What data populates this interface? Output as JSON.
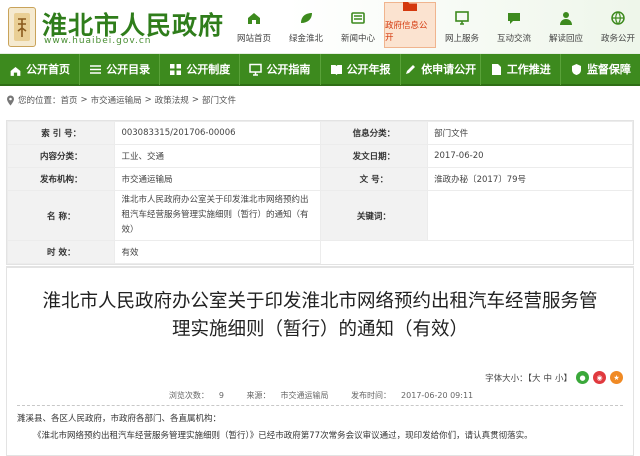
{
  "site": {
    "name": "淮北市人民政府",
    "url": "www.huaibei.gov.cn"
  },
  "topnav": [
    {
      "label": "网站首页",
      "icon": "home-icon"
    },
    {
      "label": "绿金淮北",
      "icon": "leaf-icon"
    },
    {
      "label": "新闻中心",
      "icon": "news-icon"
    },
    {
      "label": "政府信息公开",
      "icon": "folder-icon",
      "active": true
    },
    {
      "label": "网上服务",
      "icon": "computer-icon"
    },
    {
      "label": "互动交流",
      "icon": "chat-icon"
    },
    {
      "label": "解读回应",
      "icon": "person-icon"
    },
    {
      "label": "政务公开",
      "icon": "globe-icon"
    }
  ],
  "mainnav": [
    {
      "label": "公开首页",
      "icon": "home-icon"
    },
    {
      "label": "公开目录",
      "icon": "list-icon"
    },
    {
      "label": "公开制度",
      "icon": "grid-icon"
    },
    {
      "label": "公开指南",
      "icon": "monitor-icon"
    },
    {
      "label": "公开年报",
      "icon": "book-icon"
    },
    {
      "label": "依申请公开",
      "icon": "edit-icon"
    },
    {
      "label": "工作推进",
      "icon": "doc-icon"
    },
    {
      "label": "监督保障",
      "icon": "shield-icon"
    }
  ],
  "breadcrumb": {
    "prefix": "您的位置：",
    "items": [
      "首页",
      "市交通运输局",
      "政策法规",
      "部门文件"
    ],
    "sep": ">"
  },
  "meta": {
    "index_k": "索 引 号：",
    "index_v": "003083315/201706-00006",
    "info_k": "信息分类：",
    "info_v": "部门文件",
    "topic_k": "内容分类：",
    "topic_v": "工业、交通",
    "date_k": "发文日期：",
    "date_v": "2017-06-20",
    "org_k": "发布机构：",
    "org_v": "市交通运输局",
    "num_k": "文 号：",
    "num_v": "淮政办秘〔2017〕79号",
    "name_k": "名 称：",
    "name_v": "淮北市人民政府办公室关于印发淮北市网络预约出租汽车经营服务管理实施细则（暂行）的通知（有效）",
    "kw_k": "关键词：",
    "kw_v": "",
    "eff_k": "时 效：",
    "eff_v": "有效"
  },
  "doc": {
    "title": "淮北市人民政府办公室关于印发淮北市网络预约出租汽车经营服务管理实施细则（暂行）的通知（有效）",
    "font_label": "字体大小：【",
    "font_big": "大",
    "font_mid": "中",
    "font_small": "小",
    "font_end": "】",
    "views_label": "浏览次数：",
    "views": "9",
    "source_label": "来源：",
    "source": "市交通运输局",
    "time_label": "发布时间：",
    "time": "2017-06-20 09:11",
    "p1": "濉溪县、各区人民政府，市政府各部门、各直属机构：",
    "p2": "《淮北市网络预约出租汽车经营服务管理实施细则（暂行）》已经市政府第77次常务会议审议通过，现印发给你们，请认真贯彻落实。"
  },
  "colors": {
    "brand_green": "#3d8a1e",
    "active_orange": "#d4380d"
  }
}
